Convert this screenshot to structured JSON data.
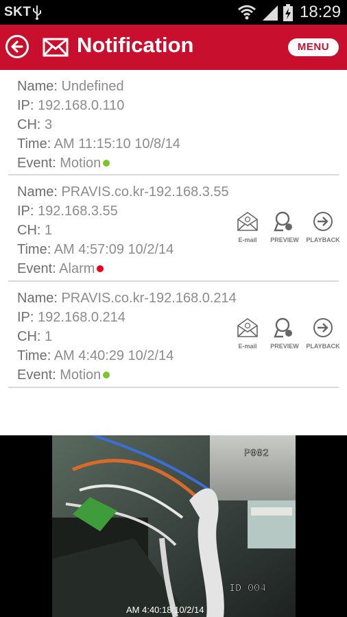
{
  "status": {
    "carrier": "SKT",
    "time": "18:29"
  },
  "header": {
    "title": "Notification",
    "menu_label": "MENU"
  },
  "labels": {
    "name": "Name:",
    "ip": "IP:",
    "ch": "CH:",
    "time": "Time:",
    "event": "Event:"
  },
  "actions": {
    "email": "E-mail",
    "preview": "PREVIEW",
    "playback": "PLAYBACK"
  },
  "notifications": [
    {
      "name": "Undefined",
      "ip": "192.168.0.110",
      "ch": "3",
      "time": "AM 11:15:10 10/8/14",
      "event": "Motion",
      "event_color": "#7cc42a"
    },
    {
      "name": "PRAVIS.co.kr-192.168.3.55",
      "ip": "192.168.3.55",
      "ch": "1",
      "time": "AM 4:57:09 10/2/14",
      "event": "Alarm",
      "event_color": "#e8001c"
    },
    {
      "name": "PRAVIS.co.kr-192.168.0.214",
      "ip": "192.168.0.214",
      "ch": "1",
      "time": "AM 4:40:29 10/2/14",
      "event": "Motion",
      "event_color": "#7cc42a"
    }
  ],
  "video": {
    "camera_label": "P002",
    "id_label": "ID 004",
    "timestamp": "AM 4:40:18 10/2/14"
  },
  "colors": {
    "brand": "#c8102e",
    "motion": "#7cc42a",
    "alarm": "#e8001c"
  }
}
